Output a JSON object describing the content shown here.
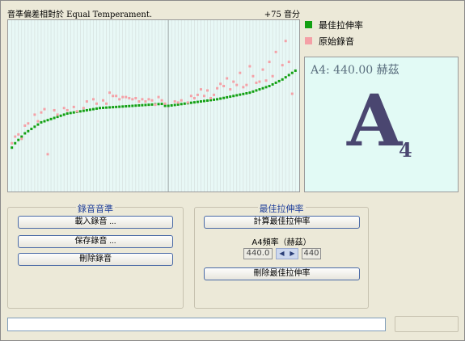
{
  "chart_header": {
    "title": "音準偏差相對於 Equal Temperament.",
    "max_label": "+75 音分"
  },
  "legend": [
    {
      "label": "最佳拉伸率",
      "color": "#12a012"
    },
    {
      "label": "原始錄音",
      "color": "#f4a0a6"
    }
  ],
  "note_display": {
    "frequency": "A4: 440.00 赫茲",
    "note_letter": "A",
    "note_octave": "4"
  },
  "recording_group": {
    "title": "錄音音準",
    "buttons": [
      "載入錄音 ...",
      "保存錄音 ...",
      "刪除錄音"
    ]
  },
  "stretch_group": {
    "title": "最佳拉伸率",
    "calc_button": "計算最佳拉伸率",
    "freq_label": "A4頻率（赫茲）",
    "freq_value": "440.0",
    "freq_ref": "440",
    "delete_button": "刪除最佳拉伸率"
  },
  "chart_data": {
    "type": "scatter",
    "title": "音準偏差相對於 Equal Temperament.",
    "ymax_label": "+75 音分",
    "ylim": [
      -75,
      75
    ],
    "highlight_key": 49,
    "series": [
      {
        "name": "最佳拉伸率",
        "color": "#12a012",
        "x": [
          1,
          2,
          3,
          4,
          5,
          6,
          7,
          8,
          9,
          10,
          11,
          12,
          13,
          14,
          15,
          16,
          17,
          18,
          19,
          20,
          21,
          22,
          23,
          24,
          25,
          26,
          27,
          28,
          29,
          30,
          31,
          32,
          33,
          34,
          35,
          36,
          37,
          38,
          39,
          40,
          41,
          42,
          43,
          44,
          45,
          46,
          47,
          48,
          49,
          50,
          51,
          52,
          53,
          54,
          55,
          56,
          57,
          58,
          59,
          60,
          61,
          62,
          63,
          64,
          65,
          66,
          67,
          68,
          69,
          70,
          71,
          72,
          73,
          74,
          75,
          76,
          77,
          78,
          79,
          80,
          81,
          82,
          83,
          84,
          85,
          86,
          87,
          88
        ],
        "y": [
          -38,
          -34,
          -31,
          -28,
          -25,
          -23,
          -21,
          -19,
          -17,
          -15,
          -14,
          -13,
          -12,
          -11,
          -10,
          -9,
          -8,
          -7,
          -6.5,
          -6,
          -5.5,
          -5,
          -4.5,
          -4,
          -3.5,
          -3,
          -2.5,
          -2,
          -1.8,
          -1.6,
          -1.4,
          -1.2,
          -1,
          -0.8,
          -0.6,
          -0.4,
          -0.2,
          0,
          0.2,
          0.4,
          0.6,
          0.8,
          1,
          1.2,
          1.4,
          1.6,
          1.8,
          0,
          0,
          0.4,
          0.8,
          1.2,
          1.6,
          2,
          2.4,
          2.8,
          3.2,
          3.6,
          4,
          4.4,
          4.8,
          5.2,
          5.6,
          6,
          6.6,
          7.2,
          7.8,
          8.4,
          9,
          9.6,
          10.2,
          10.8,
          11.4,
          12,
          13,
          14,
          15,
          16,
          17,
          18,
          19.5,
          21,
          22.5,
          24,
          26,
          28,
          30,
          32
        ]
      },
      {
        "name": "原始錄音",
        "color": "#f4a0a6",
        "x": [
          1,
          2,
          3,
          4,
          5,
          6,
          8,
          9,
          10,
          11,
          12,
          14,
          15,
          17,
          18,
          20,
          21,
          23,
          24,
          26,
          27,
          29,
          30,
          31,
          32,
          33,
          34,
          35,
          36,
          37,
          38,
          39,
          40,
          41,
          42,
          43,
          44,
          45,
          46,
          47,
          48,
          51,
          52,
          53,
          55,
          56,
          57,
          58,
          59,
          60,
          61,
          62,
          63,
          64,
          65,
          66,
          67,
          68,
          69,
          70,
          71,
          72,
          73,
          74,
          75,
          76,
          77,
          78,
          79,
          80,
          81,
          82,
          84,
          85,
          86,
          87
        ],
        "y": [
          -34,
          -28,
          -26,
          -30,
          -18,
          -16,
          -8,
          -14,
          -6,
          -3,
          -44,
          -4,
          -8,
          -2,
          -4,
          -1,
          -5,
          -2,
          4,
          6,
          2,
          5,
          2,
          12,
          9,
          9,
          6,
          8,
          8,
          7,
          6,
          7,
          4,
          6,
          4,
          6,
          5,
          1,
          8,
          5,
          2,
          4,
          3,
          5,
          3,
          9,
          7,
          10,
          15,
          9,
          14,
          7,
          10,
          16,
          20,
          18,
          25,
          15,
          22,
          19,
          30,
          17,
          19,
          36,
          27,
          21,
          22,
          33,
          23,
          40,
          27,
          49,
          37,
          59,
          40,
          11
        ]
      }
    ]
  }
}
